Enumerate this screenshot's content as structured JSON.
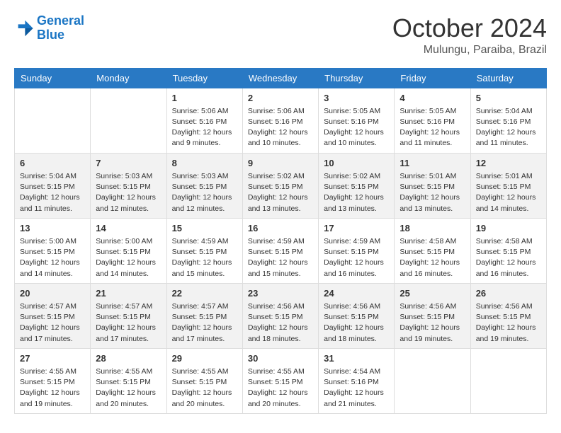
{
  "header": {
    "logo": {
      "line1": "General",
      "line2": "Blue"
    },
    "title": "October 2024",
    "location": "Mulungu, Paraiba, Brazil"
  },
  "days_of_week": [
    "Sunday",
    "Monday",
    "Tuesday",
    "Wednesday",
    "Thursday",
    "Friday",
    "Saturday"
  ],
  "weeks": [
    [
      {
        "day": "",
        "info": ""
      },
      {
        "day": "",
        "info": ""
      },
      {
        "day": "1",
        "info": "Sunrise: 5:06 AM\nSunset: 5:16 PM\nDaylight: 12 hours and 9 minutes."
      },
      {
        "day": "2",
        "info": "Sunrise: 5:06 AM\nSunset: 5:16 PM\nDaylight: 12 hours and 10 minutes."
      },
      {
        "day": "3",
        "info": "Sunrise: 5:05 AM\nSunset: 5:16 PM\nDaylight: 12 hours and 10 minutes."
      },
      {
        "day": "4",
        "info": "Sunrise: 5:05 AM\nSunset: 5:16 PM\nDaylight: 12 hours and 11 minutes."
      },
      {
        "day": "5",
        "info": "Sunrise: 5:04 AM\nSunset: 5:16 PM\nDaylight: 12 hours and 11 minutes."
      }
    ],
    [
      {
        "day": "6",
        "info": "Sunrise: 5:04 AM\nSunset: 5:15 PM\nDaylight: 12 hours and 11 minutes."
      },
      {
        "day": "7",
        "info": "Sunrise: 5:03 AM\nSunset: 5:15 PM\nDaylight: 12 hours and 12 minutes."
      },
      {
        "day": "8",
        "info": "Sunrise: 5:03 AM\nSunset: 5:15 PM\nDaylight: 12 hours and 12 minutes."
      },
      {
        "day": "9",
        "info": "Sunrise: 5:02 AM\nSunset: 5:15 PM\nDaylight: 12 hours and 13 minutes."
      },
      {
        "day": "10",
        "info": "Sunrise: 5:02 AM\nSunset: 5:15 PM\nDaylight: 12 hours and 13 minutes."
      },
      {
        "day": "11",
        "info": "Sunrise: 5:01 AM\nSunset: 5:15 PM\nDaylight: 12 hours and 13 minutes."
      },
      {
        "day": "12",
        "info": "Sunrise: 5:01 AM\nSunset: 5:15 PM\nDaylight: 12 hours and 14 minutes."
      }
    ],
    [
      {
        "day": "13",
        "info": "Sunrise: 5:00 AM\nSunset: 5:15 PM\nDaylight: 12 hours and 14 minutes."
      },
      {
        "day": "14",
        "info": "Sunrise: 5:00 AM\nSunset: 5:15 PM\nDaylight: 12 hours and 14 minutes."
      },
      {
        "day": "15",
        "info": "Sunrise: 4:59 AM\nSunset: 5:15 PM\nDaylight: 12 hours and 15 minutes."
      },
      {
        "day": "16",
        "info": "Sunrise: 4:59 AM\nSunset: 5:15 PM\nDaylight: 12 hours and 15 minutes."
      },
      {
        "day": "17",
        "info": "Sunrise: 4:59 AM\nSunset: 5:15 PM\nDaylight: 12 hours and 16 minutes."
      },
      {
        "day": "18",
        "info": "Sunrise: 4:58 AM\nSunset: 5:15 PM\nDaylight: 12 hours and 16 minutes."
      },
      {
        "day": "19",
        "info": "Sunrise: 4:58 AM\nSunset: 5:15 PM\nDaylight: 12 hours and 16 minutes."
      }
    ],
    [
      {
        "day": "20",
        "info": "Sunrise: 4:57 AM\nSunset: 5:15 PM\nDaylight: 12 hours and 17 minutes."
      },
      {
        "day": "21",
        "info": "Sunrise: 4:57 AM\nSunset: 5:15 PM\nDaylight: 12 hours and 17 minutes."
      },
      {
        "day": "22",
        "info": "Sunrise: 4:57 AM\nSunset: 5:15 PM\nDaylight: 12 hours and 17 minutes."
      },
      {
        "day": "23",
        "info": "Sunrise: 4:56 AM\nSunset: 5:15 PM\nDaylight: 12 hours and 18 minutes."
      },
      {
        "day": "24",
        "info": "Sunrise: 4:56 AM\nSunset: 5:15 PM\nDaylight: 12 hours and 18 minutes."
      },
      {
        "day": "25",
        "info": "Sunrise: 4:56 AM\nSunset: 5:15 PM\nDaylight: 12 hours and 19 minutes."
      },
      {
        "day": "26",
        "info": "Sunrise: 4:56 AM\nSunset: 5:15 PM\nDaylight: 12 hours and 19 minutes."
      }
    ],
    [
      {
        "day": "27",
        "info": "Sunrise: 4:55 AM\nSunset: 5:15 PM\nDaylight: 12 hours and 19 minutes."
      },
      {
        "day": "28",
        "info": "Sunrise: 4:55 AM\nSunset: 5:15 PM\nDaylight: 12 hours and 20 minutes."
      },
      {
        "day": "29",
        "info": "Sunrise: 4:55 AM\nSunset: 5:15 PM\nDaylight: 12 hours and 20 minutes."
      },
      {
        "day": "30",
        "info": "Sunrise: 4:55 AM\nSunset: 5:15 PM\nDaylight: 12 hours and 20 minutes."
      },
      {
        "day": "31",
        "info": "Sunrise: 4:54 AM\nSunset: 5:16 PM\nDaylight: 12 hours and 21 minutes."
      },
      {
        "day": "",
        "info": ""
      },
      {
        "day": "",
        "info": ""
      }
    ]
  ]
}
